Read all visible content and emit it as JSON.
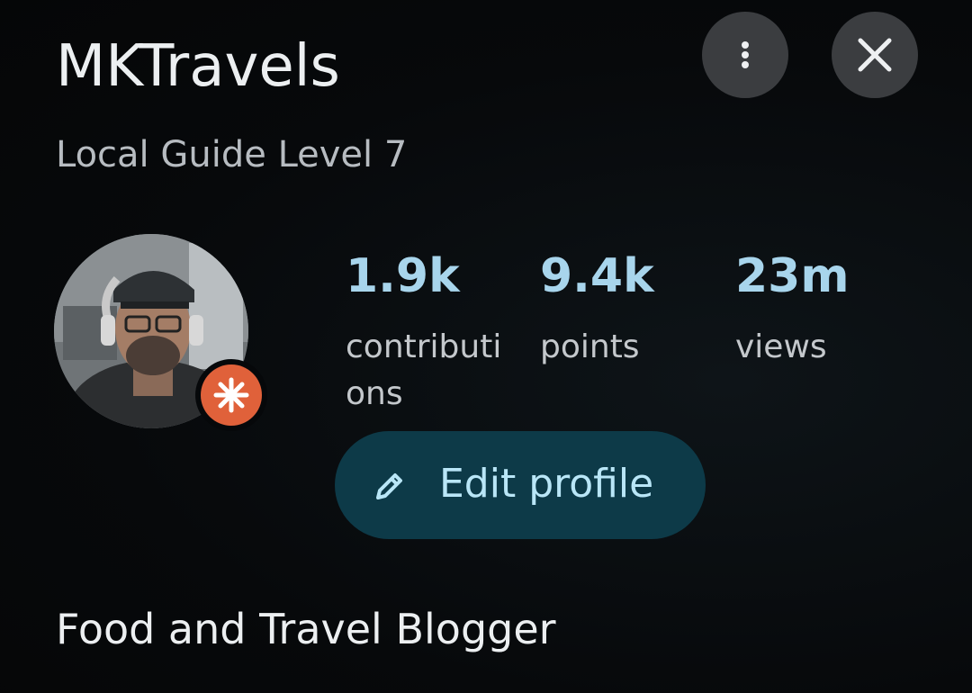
{
  "profile": {
    "name": "MKTravels",
    "level": "Local Guide Level 7",
    "bio": "Food and Travel Blogger"
  },
  "stats": [
    {
      "value": "1.9k",
      "label": "contributions"
    },
    {
      "value": "9.4k",
      "label": "points"
    },
    {
      "value": "23m",
      "label": "views"
    }
  ],
  "actions": {
    "edit_label": "Edit profile",
    "more_icon": "more-vert-icon",
    "close_icon": "close-icon"
  },
  "badge": {
    "icon": "local-guide-star-icon",
    "color": "#e0613a"
  },
  "colors": {
    "accent": "#a8d5ec",
    "button_bg": "#0d3a48",
    "button_text": "#b9e6f7"
  }
}
